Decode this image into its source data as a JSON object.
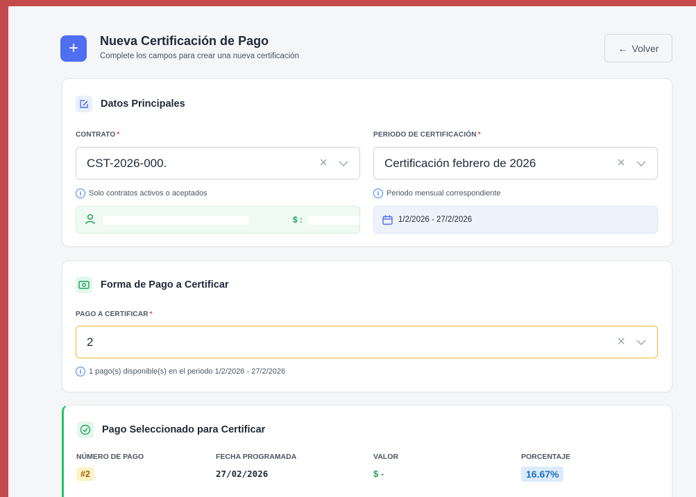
{
  "header": {
    "title": "Nueva Certificación de Pago",
    "subtitle": "Complete los campos para crear una nueva certificación",
    "plus_symbol": "+",
    "back_label": "Volver",
    "back_arrow": "←"
  },
  "datos": {
    "title": "Datos Principales",
    "contrato": {
      "label": "CONTRATO",
      "required": "*",
      "value": "CST-2026-000.",
      "clear": "×",
      "hint": "Solo contratos activos o aceptados",
      "amount_prefix": "$ :"
    },
    "periodo": {
      "label": "PERIODO DE CERTIFICACIÓN",
      "required": "*",
      "value": "Certificación febrero de 2026",
      "clear": "×",
      "hint": "Periodo mensual correspondiente",
      "date_range": "1/2/2026 - 27/2/2026"
    }
  },
  "forma": {
    "title": "Forma de Pago a Certificar",
    "label": "PAGO A CERTIFICAR",
    "required": "*",
    "value": "2",
    "clear": "×",
    "hint": "1 pago(s) disponible(s) en el periodo 1/2/2026 - 27/2/2026"
  },
  "seleccionado": {
    "title": "Pago Seleccionado para Certificar",
    "cols": {
      "numero_label": "NÚMERO DE PAGO",
      "numero_value": "#2",
      "fecha_label": "FECHA PROGRAMADA",
      "fecha_value": "27/02/2026",
      "valor_label": "VALOR",
      "valor_value": "$ -",
      "porcentaje_label": "PORCENTAJE",
      "porcentaje_value": "16.67%"
    }
  },
  "info_glyph": "i",
  "colors": {
    "accent": "#4f6ef0",
    "success": "#22c55e",
    "focus_border": "#f0b429",
    "frame": "#c24a4a"
  }
}
